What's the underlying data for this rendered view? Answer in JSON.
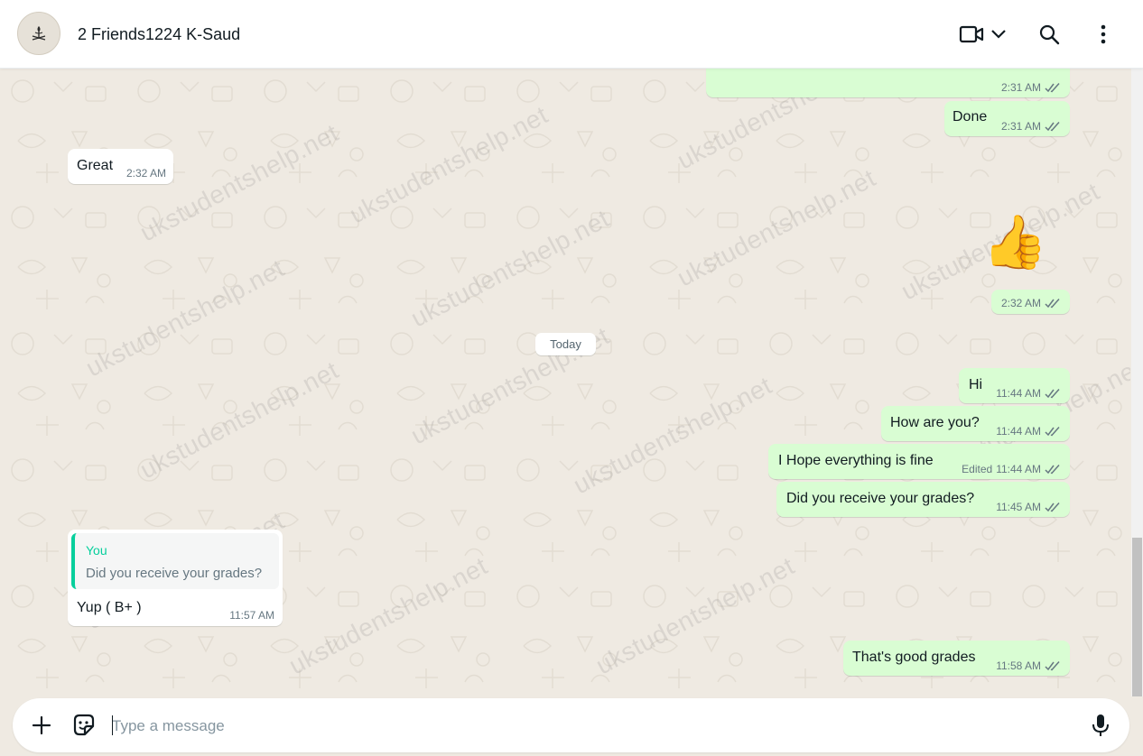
{
  "header": {
    "title": "2 Friends1224 K-Saud",
    "icons": [
      "avatar-emblem-icon",
      "video-call-icon",
      "chevron-down-icon",
      "search-icon",
      "menu-icon"
    ]
  },
  "watermark_text": "ukstudentshelp.net",
  "day_separator": "Today",
  "messages": [
    {
      "dir": "out",
      "text": "",
      "time": "2:31 AM",
      "status": "read"
    },
    {
      "dir": "out",
      "text": "Done",
      "time": "2:31 AM",
      "status": "read"
    },
    {
      "dir": "in",
      "text": "Great",
      "time": "2:32 AM"
    },
    {
      "dir": "out",
      "text": "👍",
      "time": "2:32 AM",
      "status": "read"
    },
    {
      "dir": "out",
      "text": "Hi",
      "time": "11:44 AM",
      "status": "read"
    },
    {
      "dir": "out",
      "text": "How are you?",
      "time": "11:44 AM",
      "status": "read"
    },
    {
      "dir": "out",
      "text": "I Hope everything is fine",
      "edited_label": "Edited",
      "time": "11:44 AM",
      "status": "read"
    },
    {
      "dir": "out",
      "text": "Did you receive your grades?",
      "time": "11:45 AM",
      "status": "read"
    },
    {
      "dir": "in",
      "quote_author": "You",
      "quote_text": "Did you receive your grades?",
      "text": "Yup ( B+ )",
      "time": "11:57 AM"
    },
    {
      "dir": "out",
      "text": "That's good grades",
      "time": "11:58 AM",
      "status": "read"
    }
  ],
  "composer": {
    "placeholder": "Type a message",
    "icons": [
      "plus-icon",
      "sticker-icon",
      "microphone-icon"
    ]
  },
  "colors": {
    "outgoing_bubble": "#d9fdd3",
    "incoming_bubble": "#ffffff",
    "chat_background": "#efeae2",
    "read_ticks": "#667781",
    "quote_accent": "#06cf9c"
  }
}
